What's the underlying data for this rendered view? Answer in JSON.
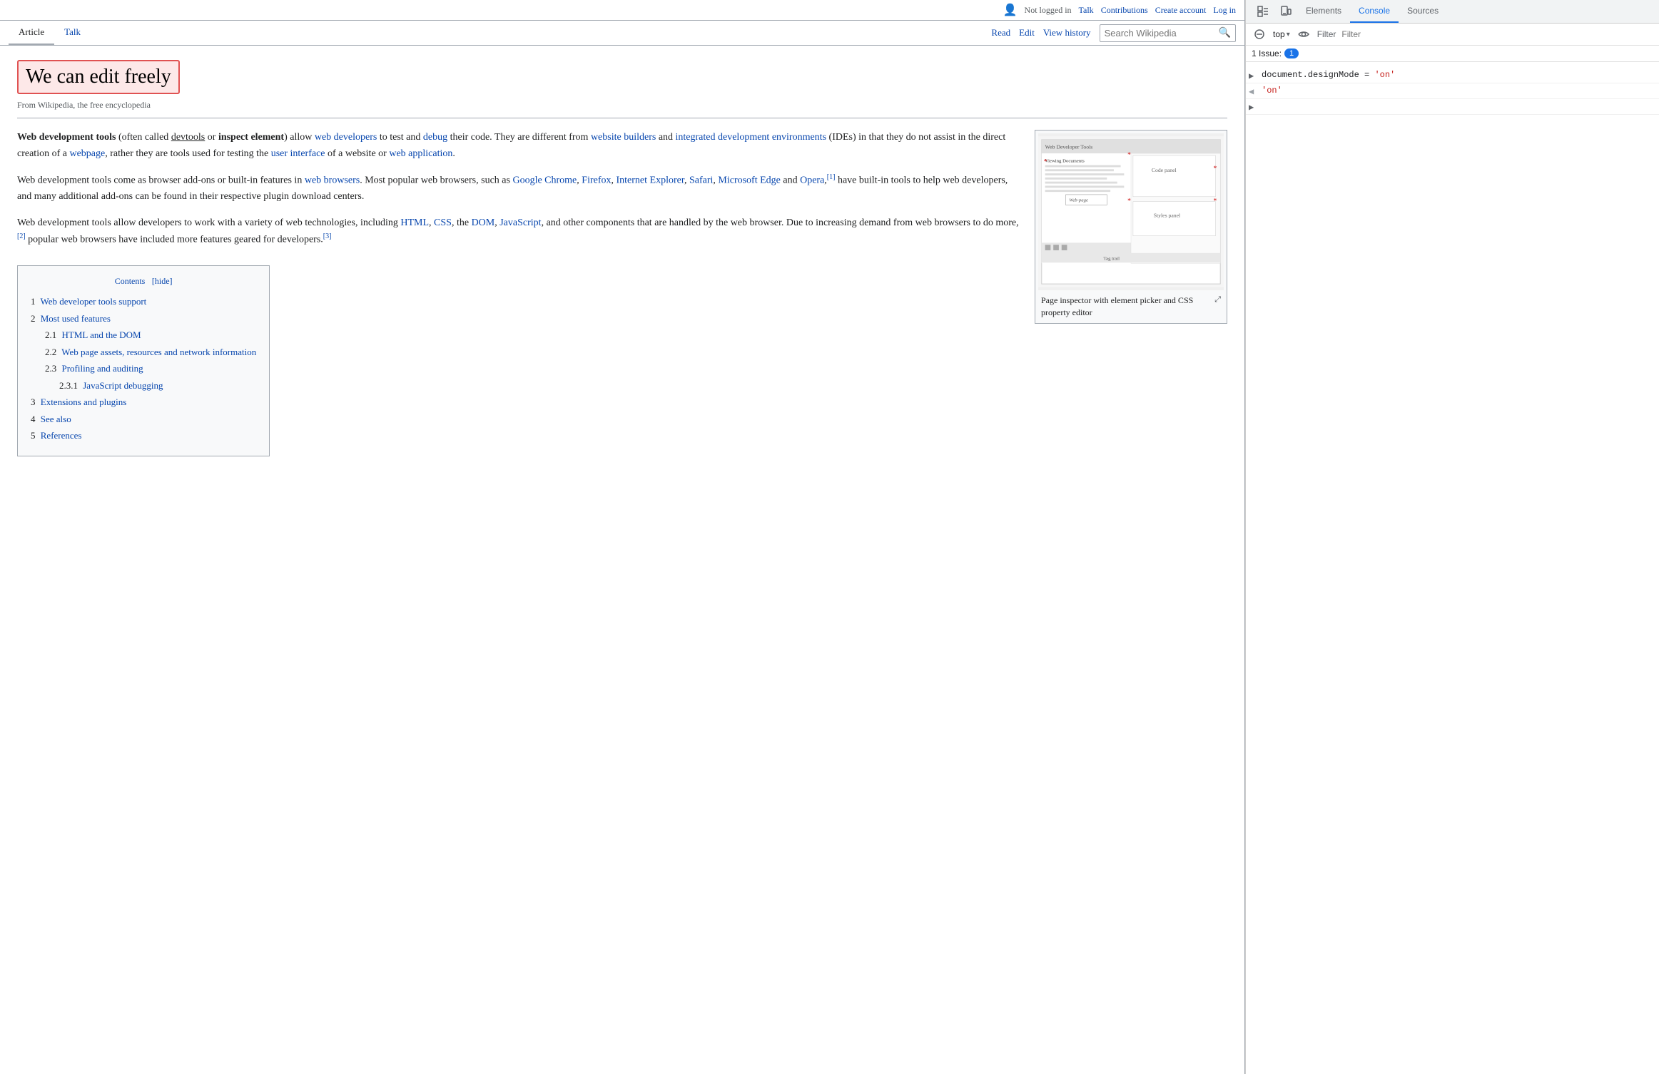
{
  "wiki": {
    "topbar": {
      "not_logged_in": "Not logged in",
      "talk": "Talk",
      "contributions": "Contributions",
      "create_account": "Create account",
      "log_in": "Log in"
    },
    "nav": {
      "article": "Article",
      "talk": "Talk",
      "read": "Read",
      "edit": "Edit",
      "view_history": "View history",
      "search_placeholder": "Search Wikipedia"
    },
    "title": "We can edit freely",
    "from_wiki": "From Wikipedia, the free encyclopedia",
    "paragraphs": [
      "Web development tools (often called devtools or inspect element) allow web developers to test and debug their code. They are different from website builders and integrated development environments (IDEs) in that they do not assist in the direct creation of a webpage, rather they are tools used for testing the user interface of a website or web application.",
      "Web development tools come as browser add-ons or built-in features in web browsers. Most popular web browsers, such as Google Chrome, Firefox, Internet Explorer, Safari, Microsoft Edge and Opera,[1] have built-in tools to help web developers, and many additional add-ons can be found in their respective plugin download centers.",
      "Web development tools allow developers to work with a variety of web technologies, including HTML, CSS, the DOM, JavaScript, and other components that are handled by the web browser. Due to increasing demand from web browsers to do more,[2] popular web browsers have included more features geared for developers.[3]"
    ],
    "image_caption": "Page inspector with element picker and CSS property editor",
    "contents": {
      "title": "Contents",
      "hide_label": "[hide]",
      "items": [
        {
          "num": "1",
          "label": "Web developer tools support",
          "sub": 0
        },
        {
          "num": "2",
          "label": "Most used features",
          "sub": 0
        },
        {
          "num": "2.1",
          "label": "HTML and the DOM",
          "sub": 1
        },
        {
          "num": "2.2",
          "label": "Web page assets, resources and network information",
          "sub": 1
        },
        {
          "num": "2.3",
          "label": "Profiling and auditing",
          "sub": 1
        },
        {
          "num": "2.3.1",
          "label": "JavaScript debugging",
          "sub": 2
        },
        {
          "num": "3",
          "label": "Extensions and plugins",
          "sub": 0
        },
        {
          "num": "4",
          "label": "See also",
          "sub": 0
        },
        {
          "num": "5",
          "label": "References",
          "sub": 0
        }
      ]
    }
  },
  "devtools": {
    "tabs": {
      "elements": "Elements",
      "console": "Console",
      "sources": "Sources"
    },
    "toolbar": {
      "top_label": "top",
      "filter_placeholder": "Filter"
    },
    "issues": {
      "label": "1 Issue:",
      "count": "1"
    },
    "console_lines": [
      {
        "type": "input",
        "arrow": "▶",
        "content": "document.designMode = 'on'"
      },
      {
        "type": "output",
        "arrow": "◀",
        "content": "'on'"
      },
      {
        "type": "expand",
        "arrow": "▶",
        "content": ""
      }
    ]
  }
}
